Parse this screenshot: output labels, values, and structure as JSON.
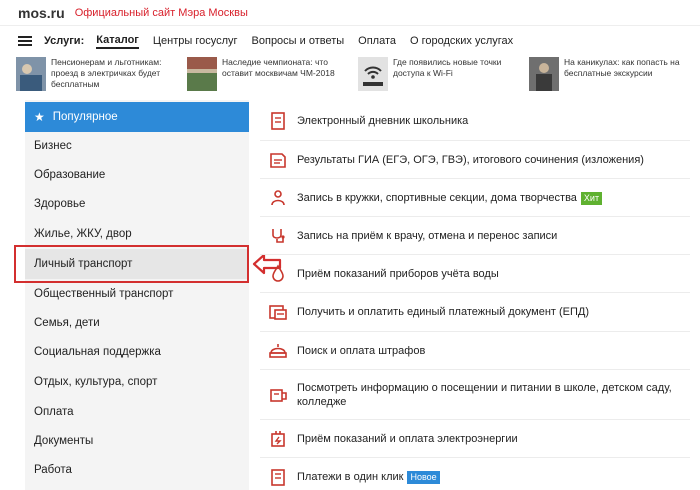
{
  "header": {
    "logo": "mos.ru",
    "site_title": "Официальный сайт Мэра Москвы"
  },
  "nav": {
    "services_label": "Услуги:",
    "items": [
      "Каталог",
      "Центры госуслуг",
      "Вопросы и ответы",
      "Оплата",
      "О городских услугах"
    ]
  },
  "news": [
    {
      "text": "Пенсионерам и льготникам: проезд в электричках будет бесплатным"
    },
    {
      "text": "Наследие чемпионата: что оставит москвичам ЧМ-2018"
    },
    {
      "text": "Где появились новые точки доступа к Wi-Fi"
    },
    {
      "text": "На каникулах: как попасть на бесплатные экскурсии"
    }
  ],
  "categories": [
    "Популярное",
    "Бизнес",
    "Образование",
    "Здоровье",
    "Жилье, ЖКУ, двор",
    "Личный транспорт",
    "Общественный транспорт",
    "Семья, дети",
    "Социальная поддержка",
    "Отдых, культура, спорт",
    "Оплата",
    "Документы",
    "Работа"
  ],
  "selected_category": "Личный транспорт",
  "services": [
    {
      "label": "Электронный дневник школьника",
      "icon": "school-diary-icon"
    },
    {
      "label": "Результаты ГИА (ЕГЭ, ОГЭ, ГВЭ), итогового сочинения (изложения)",
      "icon": "exam-results-icon"
    },
    {
      "label": "Запись в кружки, спортивные секции, дома творчества",
      "icon": "clubs-icon",
      "badge": "Хит"
    },
    {
      "label": "Запись на приём к врачу, отмена и перенос записи",
      "icon": "doctor-icon"
    },
    {
      "label": "Приём показаний приборов учёта воды",
      "icon": "water-meter-icon"
    },
    {
      "label": "Получить и оплатить единый платежный документ (ЕПД)",
      "icon": "payment-document-icon"
    },
    {
      "label": "Поиск и оплата штрафов",
      "icon": "fines-icon"
    },
    {
      "label": "Посмотреть информацию о посещении и питании в школе, детском саду, колледже",
      "icon": "school-attendance-icon"
    },
    {
      "label": "Приём показаний и оплата электроэнергии",
      "icon": "electricity-icon"
    },
    {
      "label": "Платежи в один клик",
      "icon": "one-click-payment-icon",
      "badge": "Новое"
    }
  ],
  "colors": {
    "brand_red": "#d8202b",
    "accent_blue": "#2d8ad8",
    "badge_green": "#5fb130",
    "highlight_red": "#d32f2f"
  }
}
